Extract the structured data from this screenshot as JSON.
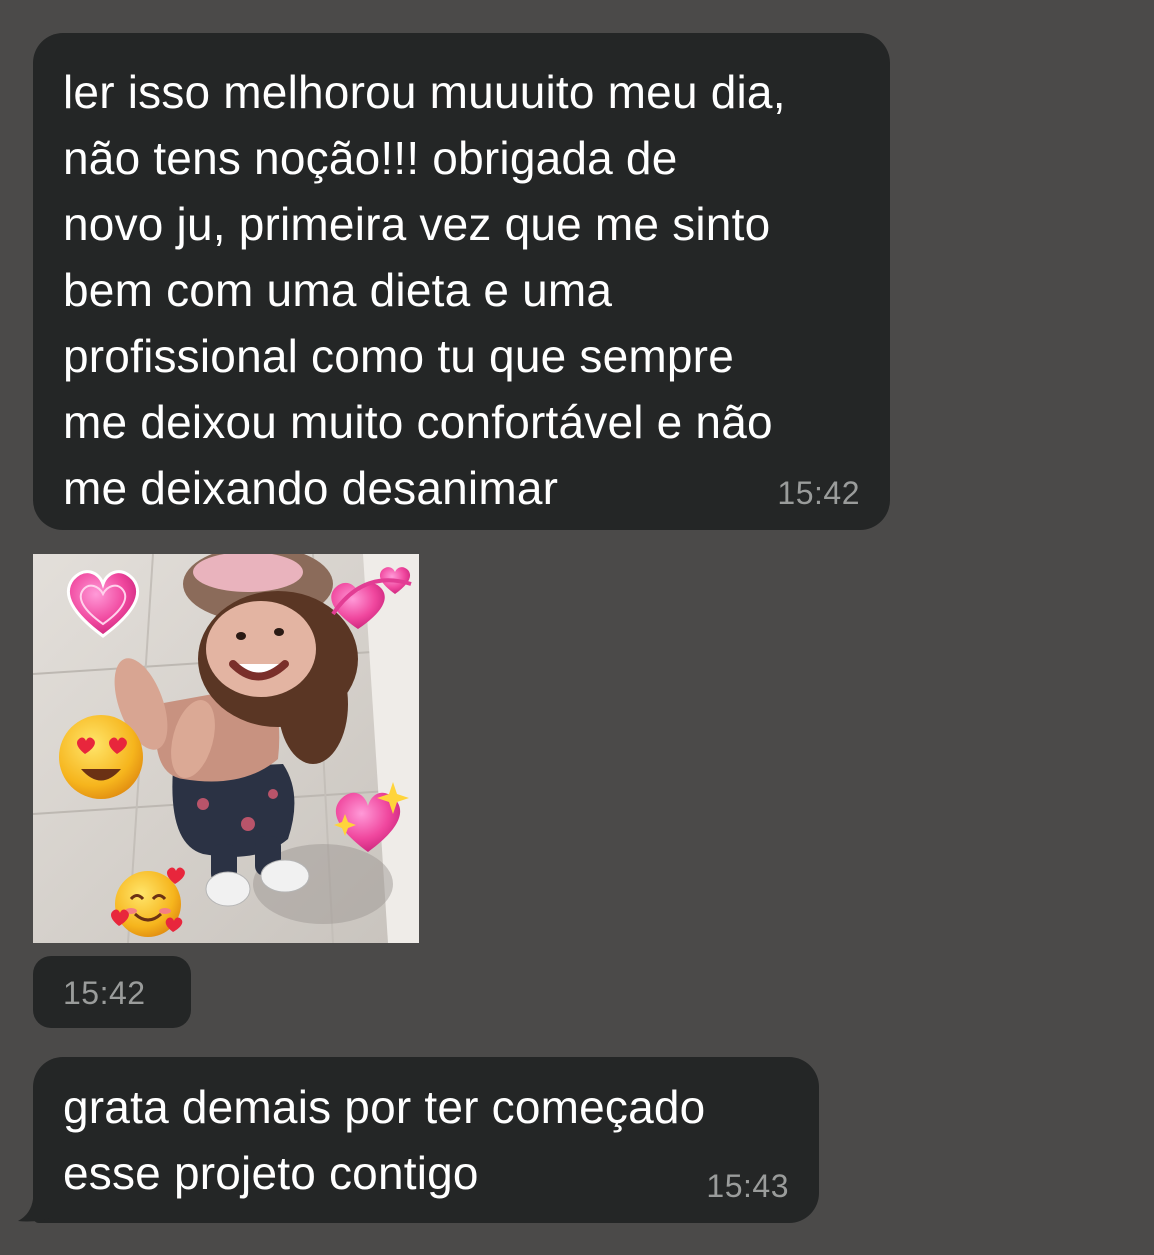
{
  "colors": {
    "background": "#4b4a49",
    "bubble": "#242626",
    "text": "#ffffff",
    "timestamp": "#9a9c9b"
  },
  "messages": [
    {
      "text": "ler isso melhorou muuuito meu dia,\nnão tens noção!!! obrigada de\nnovo ju, primeira vez que me sinto\nbem com uma dieta e uma\nprofissional como tu que sempre\nme deixou muito confortável e não\nme deixando desanimar",
      "time": "15:42"
    },
    {
      "media": "photo of a smiling child with heart and smiling-face stickers",
      "icons": [
        "heart-icon",
        "revolving-hearts-icon",
        "heart-eyes-emoji-icon",
        "sparkling-heart-icon",
        "smiling-face-with-hearts-icon"
      ],
      "time": "15:42"
    },
    {
      "text": "grata demais por ter começado\nesse projeto contigo",
      "time": "15:43"
    }
  ]
}
